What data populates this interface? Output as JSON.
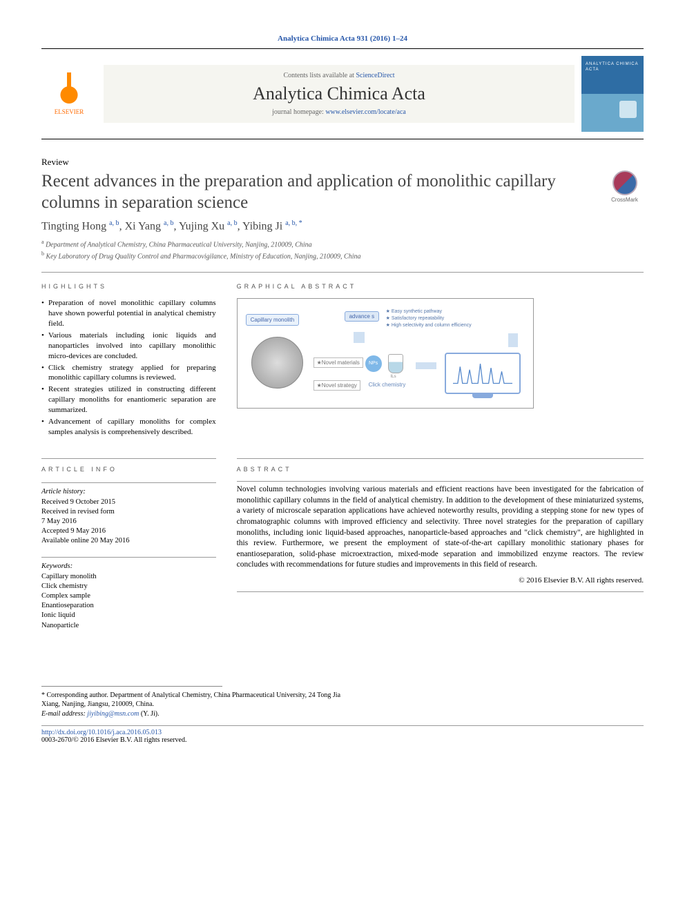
{
  "top_citation": "Analytica Chimica Acta 931 (2016) 1–24",
  "masthead": {
    "publisher": "ELSEVIER",
    "contents_prefix": "Contents lists available at ",
    "contents_link": "ScienceDirect",
    "journal": "Analytica Chimica Acta",
    "homepage_prefix": "journal homepage: ",
    "homepage_url": "www.elsevier.com/locate/aca"
  },
  "article_type": "Review",
  "title": "Recent advances in the preparation and application of monolithic capillary columns in separation science",
  "crossmark": "CrossMark",
  "authors_html": "Tingting Hong <sup>a, b</sup>, Xi Yang <sup>a, b</sup>, Yujing Xu <sup>a, b</sup>, Yibing Ji <sup>a, b, <span class='ast'>*</span></sup>",
  "affiliations": [
    {
      "sup": "a",
      "text": "Department of Analytical Chemistry, China Pharmaceutical University, Nanjing, 210009, China"
    },
    {
      "sup": "b",
      "text": "Key Laboratory of Drug Quality Control and Pharmacovigilance, Ministry of Education, Nanjing, 210009, China"
    }
  ],
  "sections": {
    "highlights": "HIGHLIGHTS",
    "graphical": "GRAPHICAL ABSTRACT",
    "info": "ARTICLE INFO",
    "abstract": "ABSTRACT"
  },
  "highlights": [
    "Preparation of novel monolithic capillary columns have shown powerful potential in analytical chemistry field.",
    "Various materials including ionic liquids and nanoparticles involved into capillary monolithic micro-devices are concluded.",
    "Click chemistry strategy applied for preparing monolithic capillary columns is reviewed.",
    "Recent strategies utilized in constructing different capillary monoliths for enantiomeric separation are summarized.",
    "Advancement of capillary monoliths for complex samples analysis is comprehensively described."
  ],
  "graphical_abstract": {
    "cap_mono": "Capillary monolith",
    "advance": "advance s",
    "bullets": "★ Easy synthetic pathway\n★ Satisfactory repeatability\n★ High selectivity and column efficiency",
    "novel_mat": "★Novel materials",
    "nps": "NPs",
    "ils": "ILs",
    "novel_strategy": "★Novel strategy",
    "click": "Click chemistry"
  },
  "article_info": {
    "history_head": "Article history:",
    "received": "Received 9 October 2015",
    "revised": "Received in revised form\n7 May 2016",
    "accepted": "Accepted 9 May 2016",
    "online": "Available online 20 May 2016",
    "keywords_head": "Keywords:",
    "keywords": [
      "Capillary monolith",
      "Click chemistry",
      "Complex sample",
      "Enantioseparation",
      "Ionic liquid",
      "Nanoparticle"
    ]
  },
  "abstract": "Novel column technologies involving various materials and efficient reactions have been investigated for the fabrication of monolithic capillary columns in the field of analytical chemistry. In addition to the development of these miniaturized systems, a variety of microscale separation applications have achieved noteworthy results, providing a stepping stone for new types of chromatographic columns with improved efficiency and selectivity. Three novel strategies for the preparation of capillary monoliths, including ionic liquid-based approaches, nanoparticle-based approaches and \"click chemistry\", are highlighted in this review. Furthermore, we present the employment of state-of-the-art capillary monolithic stationary phases for enantioseparation, solid-phase microextraction, mixed-mode separation and immobilized enzyme reactors. The review concludes with recommendations for future studies and improvements in this field of research.",
  "copyright": "© 2016 Elsevier B.V. All rights reserved.",
  "correspondence": {
    "asterisk": "*",
    "text": "Corresponding author. Department of Analytical Chemistry, China Pharmaceutical University, 24 Tong Jia Xiang, Nanjing, Jiangsu, 210009, China.",
    "email_label": "E-mail address:",
    "email": "jiyibing@msn.com",
    "email_name": "(Y. Ji)."
  },
  "doi": {
    "url": "http://dx.doi.org/10.1016/j.aca.2016.05.013",
    "issn_line": "0003-2670/© 2016 Elsevier B.V. All rights reserved."
  }
}
